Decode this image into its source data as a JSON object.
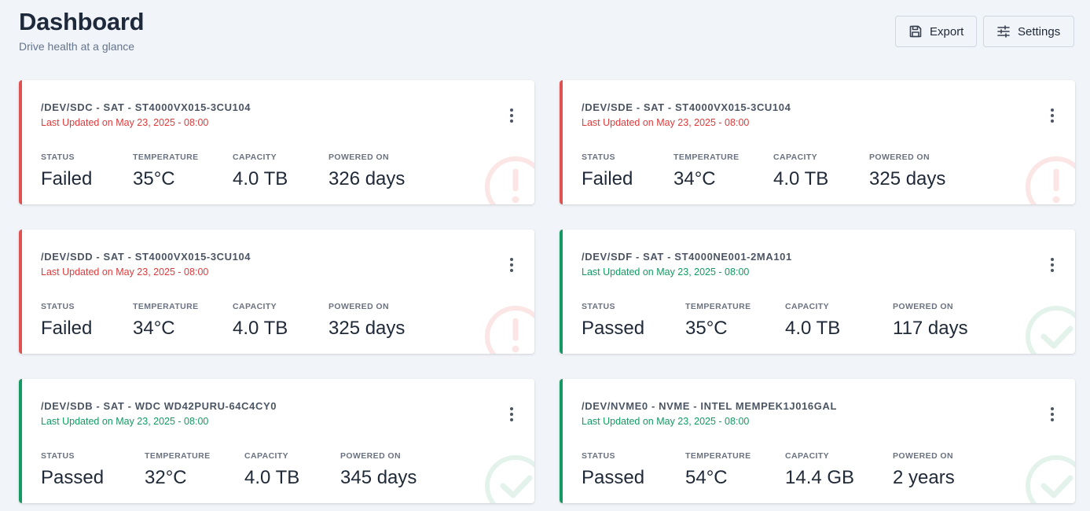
{
  "header": {
    "title": "Dashboard",
    "subtitle": "Drive health at a glance"
  },
  "toolbar": {
    "export_label": "Export",
    "settings_label": "Settings"
  },
  "labels": {
    "status": "STATUS",
    "temperature": "TEMPERATURE",
    "capacity": "CAPACITY",
    "powered_on": "POWERED ON"
  },
  "colors": {
    "failed": "#e05252",
    "passed": "#139a62",
    "failed_icon_bg": "#fbe5e5",
    "passed_icon_bg": "#e3f3ec"
  },
  "cards": [
    {
      "title": "/DEV/SDC - SAT - ST4000VX015-3CU104",
      "updated": "Last Updated on May 23, 2025 - 08:00",
      "status": "Failed",
      "temperature": "35°C",
      "capacity": "4.0 TB",
      "powered_on": "326 days",
      "health": "failed",
      "icon": "alert-icon"
    },
    {
      "title": "/DEV/SDE - SAT - ST4000VX015-3CU104",
      "updated": "Last Updated on May 23, 2025 - 08:00",
      "status": "Failed",
      "temperature": "34°C",
      "capacity": "4.0 TB",
      "powered_on": "325 days",
      "health": "failed",
      "icon": "alert-icon"
    },
    {
      "title": "/DEV/SDD - SAT - ST4000VX015-3CU104",
      "updated": "Last Updated on May 23, 2025 - 08:00",
      "status": "Failed",
      "temperature": "34°C",
      "capacity": "4.0 TB",
      "powered_on": "325 days",
      "health": "failed",
      "icon": "alert-icon"
    },
    {
      "title": "/DEV/SDF - SAT - ST4000NE001-2MA101",
      "updated": "Last Updated on May 23, 2025 - 08:00",
      "status": "Passed",
      "temperature": "35°C",
      "capacity": "4.0 TB",
      "powered_on": "117 days",
      "health": "passed",
      "icon": "check-icon"
    },
    {
      "title": "/DEV/SDB - SAT - WDC WD42PURU-64C4CY0",
      "updated": "Last Updated on May 23, 2025 - 08:00",
      "status": "Passed",
      "temperature": "32°C",
      "capacity": "4.0 TB",
      "powered_on": "345 days",
      "health": "passed",
      "icon": "check-icon"
    },
    {
      "title": "/DEV/NVME0 - NVME - INTEL MEMPEK1J016GAL",
      "updated": "Last Updated on May 23, 2025 - 08:00",
      "status": "Passed",
      "temperature": "54°C",
      "capacity": "14.4 GB",
      "powered_on": "2 years",
      "health": "passed",
      "icon": "check-icon"
    }
  ]
}
